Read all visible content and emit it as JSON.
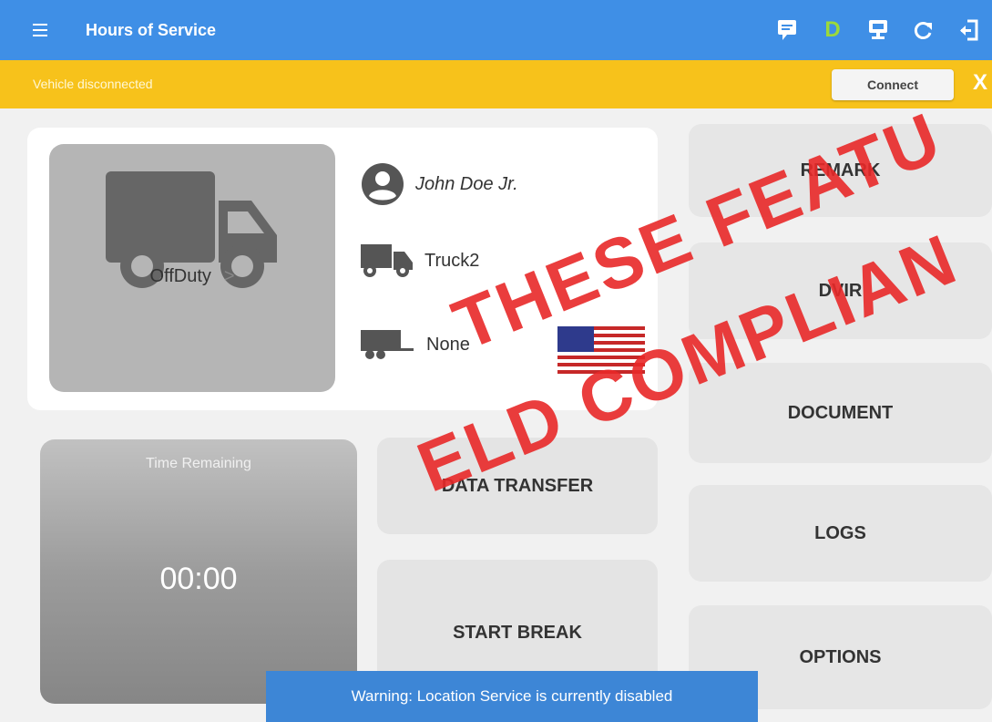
{
  "appbar": {
    "title": "Hours of Service",
    "duty_letter": "D",
    "icons": [
      "menu-icon",
      "message-icon",
      "driver-status-icon",
      "monitor-icon",
      "refresh-icon",
      "logout-icon"
    ],
    "color": "#3f8fe6"
  },
  "banner": {
    "text": "Vehicle disconnected",
    "connect_label": "Connect",
    "close_label": "X",
    "color": "#f7c21b"
  },
  "info": {
    "status": "OffDuty",
    "status_chevron": ">",
    "driver": "John Doe Jr.",
    "vehicle": "Truck2",
    "trailer": "None"
  },
  "time": {
    "label": "Time Remaining",
    "value": "00:00"
  },
  "actions": {
    "data_transfer": "DATA TRANSFER",
    "start_break": "START BREAK"
  },
  "side": {
    "remark": "REMARK",
    "dvir": "DVIR",
    "document": "DOCUMENT",
    "logs": "LOGS",
    "options": "OPTIONS"
  },
  "snackbar": {
    "text": "Warning: Location Service is currently disabled"
  },
  "watermark": {
    "line1": "THESE FEATU",
    "line2": "ELD COMPLIAN"
  }
}
